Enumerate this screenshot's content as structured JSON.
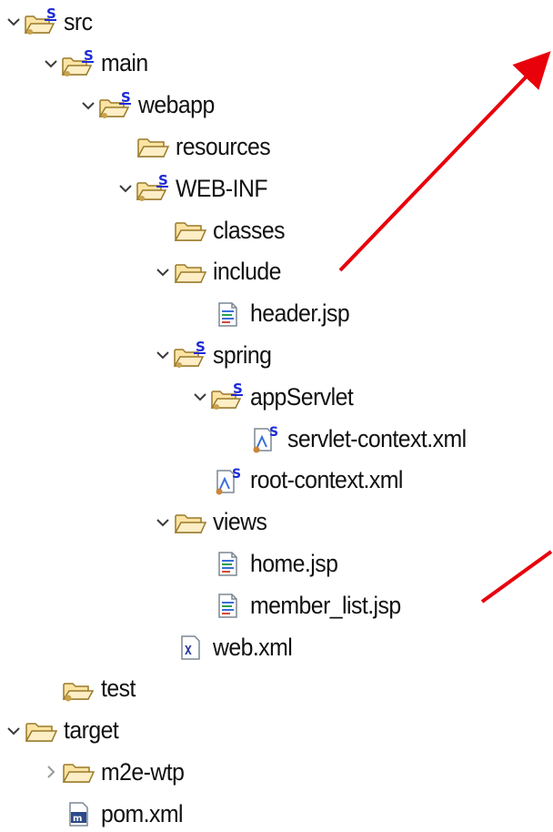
{
  "tree": {
    "items": [
      {
        "label": "src",
        "icon": "source-folder-icon",
        "depth": 0,
        "expander": "expanded"
      },
      {
        "label": "main",
        "icon": "source-folder-icon",
        "depth": 1,
        "expander": "expanded"
      },
      {
        "label": "webapp",
        "icon": "source-folder-icon",
        "depth": 2,
        "expander": "expanded"
      },
      {
        "label": "resources",
        "icon": "folder-icon",
        "depth": 3,
        "expander": "none"
      },
      {
        "label": "WEB-INF",
        "icon": "source-folder-icon",
        "depth": 3,
        "expander": "expanded"
      },
      {
        "label": "classes",
        "icon": "folder-icon",
        "depth": 4,
        "expander": "none"
      },
      {
        "label": "include",
        "icon": "folder-icon",
        "depth": 4,
        "expander": "expanded"
      },
      {
        "label": "header.jsp",
        "icon": "jsp-file-icon",
        "depth": 5,
        "expander": "none"
      },
      {
        "label": "spring",
        "icon": "source-folder-icon",
        "depth": 4,
        "expander": "expanded"
      },
      {
        "label": "appServlet",
        "icon": "source-folder-icon",
        "depth": 5,
        "expander": "expanded"
      },
      {
        "label": "servlet-context.xml",
        "icon": "spring-bean-file-icon",
        "depth": 6,
        "expander": "none"
      },
      {
        "label": "root-context.xml",
        "icon": "spring-bean-file-icon",
        "depth": 5,
        "expander": "none"
      },
      {
        "label": "views",
        "icon": "folder-icon",
        "depth": 4,
        "expander": "expanded"
      },
      {
        "label": "home.jsp",
        "icon": "jsp-file-icon",
        "depth": 5,
        "expander": "none"
      },
      {
        "label": "member_list.jsp",
        "icon": "jsp-file-icon",
        "depth": 5,
        "expander": "none"
      },
      {
        "label": "web.xml",
        "icon": "xml-file-icon",
        "depth": 4,
        "expander": "none"
      },
      {
        "label": "test",
        "icon": "maven-source-folder-icon",
        "depth": 1,
        "expander": "none"
      },
      {
        "label": "target",
        "icon": "folder-icon",
        "depth": 0,
        "expander": "expanded"
      },
      {
        "label": "m2e-wtp",
        "icon": "folder-icon",
        "depth": 1,
        "expander": "collapsed"
      },
      {
        "label": "pom.xml",
        "icon": "maven-pom-icon",
        "depth": 1,
        "expander": "none"
      }
    ]
  },
  "colors": {
    "annotation_arrow": "#e8000b",
    "folder_fill": "#fbe3a4",
    "folder_stroke": "#9a7a2a",
    "spring_badge": "#1d2bd6"
  }
}
